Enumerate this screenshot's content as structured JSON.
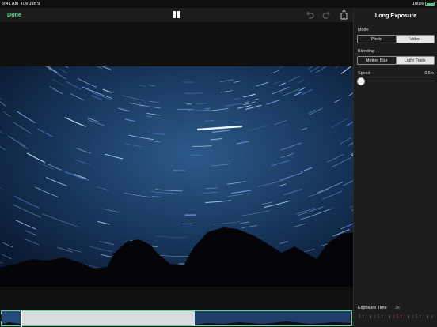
{
  "status_bar": {
    "time": "9:41 AM",
    "date": "Tue Jan 9",
    "battery_percent": "100%",
    "battery_level": 1.0
  },
  "toolbar": {
    "done_label": "Done",
    "icons": [
      "pause-icon",
      "undo-icon",
      "redo-icon",
      "share-icon"
    ]
  },
  "panel": {
    "title": "Long Exposure",
    "mode": {
      "label": "Mode",
      "options": [
        "Photo",
        "Video"
      ],
      "selected": "Video"
    },
    "blending": {
      "label": "Blending",
      "options": [
        "Motion Blur",
        "Light Trails"
      ],
      "selected": "Light Trails"
    },
    "speed": {
      "label": "Speed",
      "value_text": "0.5 x",
      "level": 0.0
    },
    "exposure": {
      "label": "Exposure Time",
      "value": "3s"
    }
  },
  "colors": {
    "accent": "#55df9c",
    "panel_bg": "#1d1d1d",
    "toolbar_bg": "#1c1c1c"
  }
}
